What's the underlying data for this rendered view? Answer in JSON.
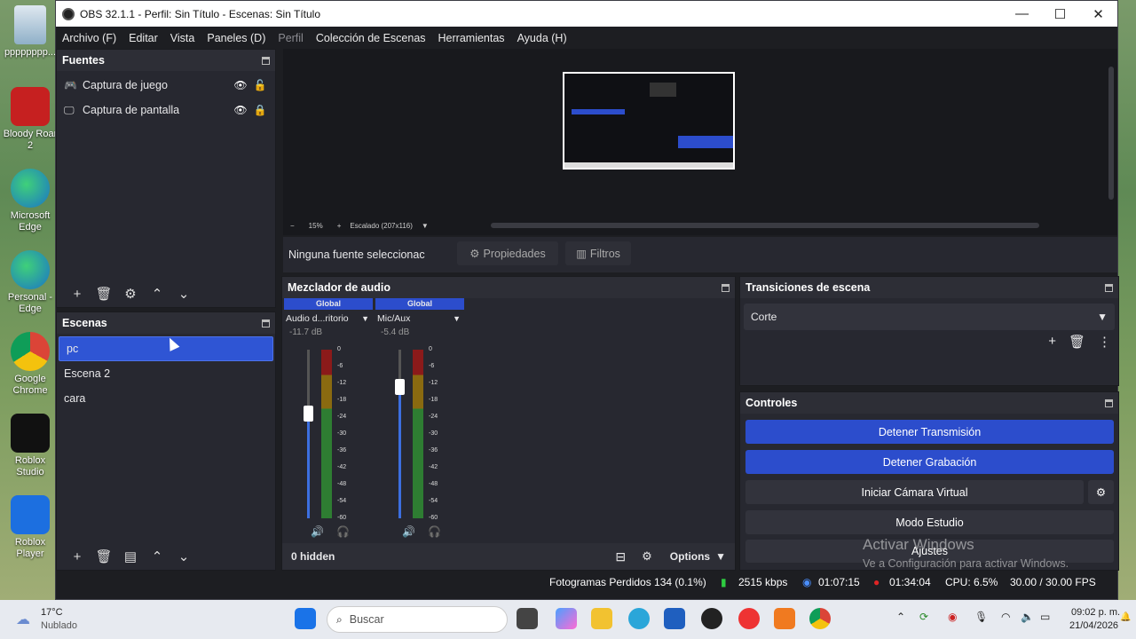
{
  "desktop": {
    "icons": [
      {
        "label": "pppppppp..."
      },
      {
        "label": "Bloody Roar 2"
      },
      {
        "label": "Microsoft Edge"
      },
      {
        "label": "Personal - Edge"
      },
      {
        "label": "Google Chrome"
      },
      {
        "label": "Roblox Studio"
      },
      {
        "label": "Roblox Player"
      }
    ]
  },
  "window": {
    "title": "OBS 32.1.1 - Perfil: Sin Título - Escenas: Sin Título",
    "minimize": "—",
    "maximize": "☐",
    "close": "✕"
  },
  "menu": [
    "Archivo (F)",
    "Editar",
    "Vista",
    "Paneles (D)",
    "Perfil",
    "Colección de Escenas",
    "Herramientas",
    "Ayuda (H)"
  ],
  "sources": {
    "title": "Fuentes",
    "items": [
      {
        "label": "Captura de juego"
      },
      {
        "label": "Captura de pantalla"
      }
    ]
  },
  "scenes": {
    "title": "Escenas",
    "items": [
      {
        "label": "pc"
      },
      {
        "label": "Escena 2"
      },
      {
        "label": "cara"
      }
    ]
  },
  "preview": {
    "zoom": "15%",
    "scale": "Escalado (207x116)"
  },
  "context": {
    "none_selected": "Ninguna fuente seleccionac",
    "properties": "Propiedades",
    "filters": "Filtros"
  },
  "mixer": {
    "title": "Mezclador de audio",
    "channels": [
      {
        "tag": "Global",
        "name": "Audio d...ritorio",
        "db": "-11.7 dB",
        "level": 0.62
      },
      {
        "tag": "Global",
        "name": "Mic/Aux",
        "db": "-5.4 dB",
        "level": 0.78
      }
    ],
    "scale": [
      "0",
      "-6",
      "-12",
      "-18",
      "-24",
      "-30",
      "-36",
      "-42",
      "-48",
      "-54",
      "-60"
    ],
    "hidden": "0 hidden",
    "options": "Options"
  },
  "transitions": {
    "title": "Transiciones de escena",
    "selected": "Corte"
  },
  "controls": {
    "title": "Controles",
    "stop_stream": "Detener Transmisión",
    "stop_record": "Detener Grabación",
    "virtual_cam": "Iniciar Cámara Virtual",
    "studio": "Modo Estudio",
    "settings": "Ajustes",
    "activate_title": "Activar Windows",
    "activate_sub": "Ve a Configuración para activar Windows."
  },
  "status": {
    "dropped": "Fotogramas Perdidos 134 (0.1%)",
    "bitrate": "2515 kbps",
    "stream_time": "01:07:15",
    "rec_time": "01:34:04",
    "cpu": "CPU: 6.5%",
    "fps": "30.00 / 30.00 FPS"
  },
  "taskbar": {
    "temp": "17°C",
    "weather": "Nublado",
    "search": "Buscar",
    "time": "09:02 p. m.",
    "date": "21/04/2026"
  },
  "colors": {
    "accent": "#2c4dcc",
    "selected": "#2f55d4",
    "recording": "#e02424"
  }
}
